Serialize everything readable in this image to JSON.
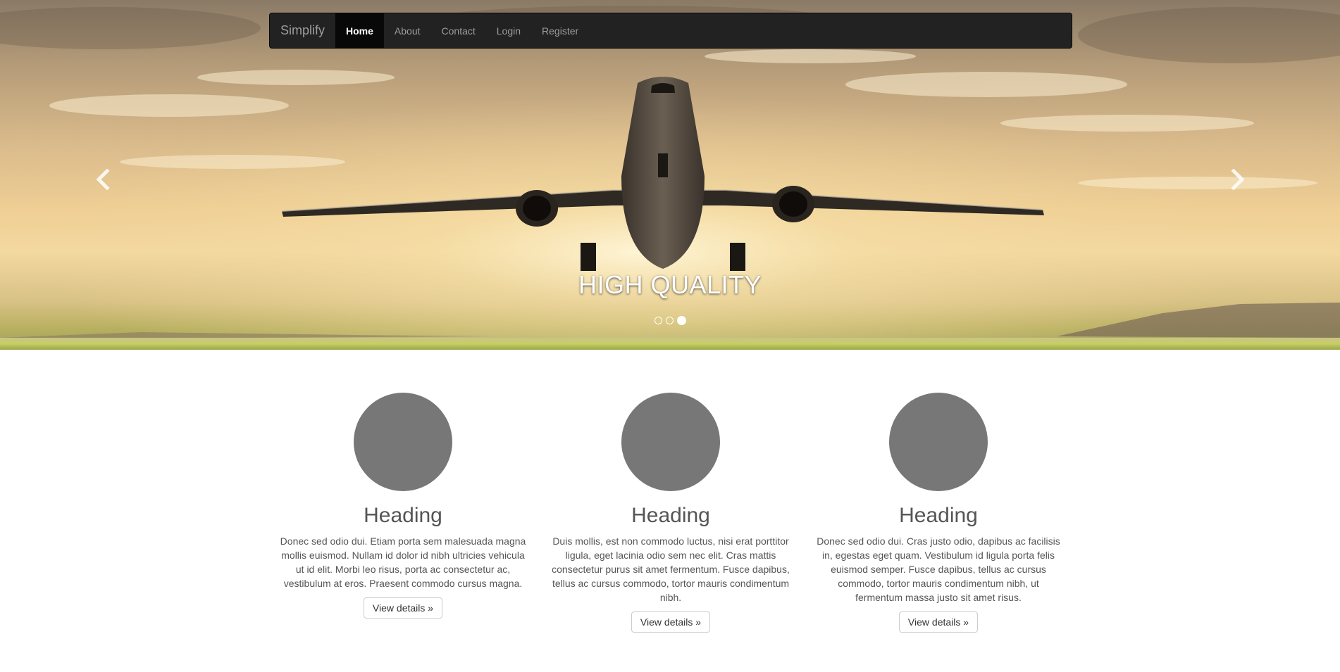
{
  "navbar": {
    "brand": "Simplify",
    "items": [
      {
        "label": "Home",
        "active": true
      },
      {
        "label": "About",
        "active": false
      },
      {
        "label": "Contact",
        "active": false
      },
      {
        "label": "Login",
        "active": false
      },
      {
        "label": "Register",
        "active": false
      }
    ]
  },
  "carousel": {
    "caption": "HIGH QUALITY",
    "slide_count": 3,
    "active_slide": 3,
    "prev_icon": "chevron-left-icon",
    "next_icon": "chevron-right-icon"
  },
  "columns": [
    {
      "heading": "Heading",
      "text": "Donec sed odio dui. Etiam porta sem malesuada magna mollis euismod. Nullam id dolor id nibh ultricies vehicula ut id elit. Morbi leo risus, porta ac consectetur ac, vestibulum at eros. Praesent commodo cursus magna.",
      "button": "View details »"
    },
    {
      "heading": "Heading",
      "text": "Duis mollis, est non commodo luctus, nisi erat porttitor ligula, eget lacinia odio sem nec elit. Cras mattis consectetur purus sit amet fermentum. Fusce dapibus, tellus ac cursus commodo, tortor mauris condimentum nibh.",
      "button": "View details »"
    },
    {
      "heading": "Heading",
      "text": "Donec sed odio dui. Cras justo odio, dapibus ac facilisis in, egestas eget quam. Vestibulum id ligula porta felis euismod semper. Fusce dapibus, tellus ac cursus commodo, tortor mauris condimentum nibh, ut fermentum massa justo sit amet risus.",
      "button": "View details »"
    }
  ],
  "colors": {
    "navbar_bg": "#222222",
    "nav_active_bg": "#080808",
    "placeholder_circle": "#777777"
  }
}
